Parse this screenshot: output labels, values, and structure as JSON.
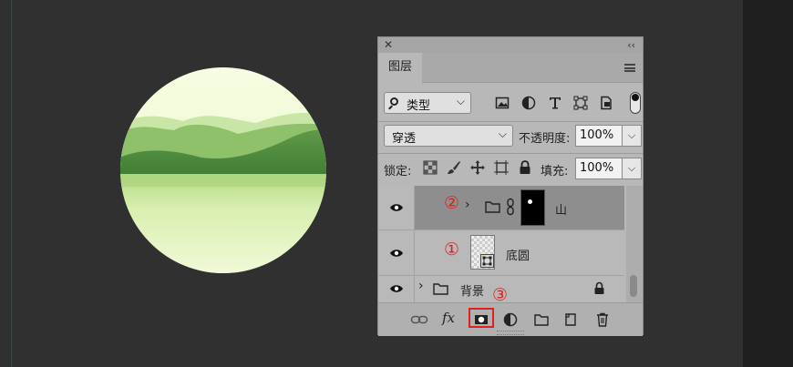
{
  "panel": {
    "tab_label": "图层",
    "filter": {
      "label": "类型",
      "icon": "search-icon"
    },
    "blend_mode": "穿透",
    "opacity_label": "不透明度:",
    "opacity_value": "100%",
    "lock_label": "锁定:",
    "fill_label": "填充:",
    "fill_value": "100%",
    "layers": [
      {
        "name": "山",
        "type": "group",
        "selected": true,
        "annotation": "②"
      },
      {
        "name": "底圆",
        "type": "shape",
        "selected": false,
        "annotation": "①"
      },
      {
        "name": "背景",
        "type": "group",
        "selected": false,
        "locked": true
      }
    ],
    "bottom_annotation": "③",
    "fx_label": "fx"
  },
  "colors": {
    "canvas": "#303030",
    "panel": "#b8b8b8",
    "selected_row": "#8e8e8e",
    "annotation_red": "#e02020",
    "art_light": "#eef9d6",
    "art_dark": "#4e8b3c"
  }
}
